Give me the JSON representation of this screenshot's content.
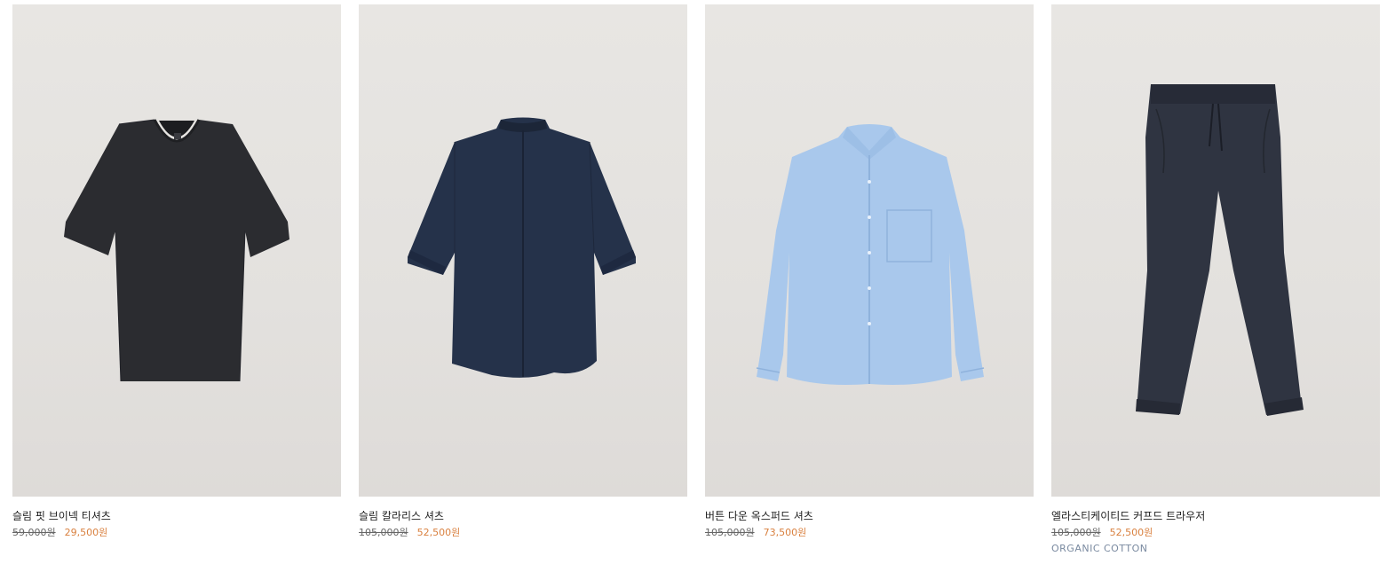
{
  "products": [
    {
      "image_alt": "black-vneck-tshirt",
      "name": "슬림 핏 브이넥 티셔츠",
      "original_price": "59,000원",
      "sale_price": "29,500원",
      "tag": ""
    },
    {
      "image_alt": "navy-collarless-shirt",
      "name": "슬림 칼라리스 셔츠",
      "original_price": "105,000원",
      "sale_price": "52,500원",
      "tag": ""
    },
    {
      "image_alt": "light-blue-oxford-shirt",
      "name": "버튼 다운 옥스퍼드 셔츠",
      "original_price": "105,000원",
      "sale_price": "73,500원",
      "tag": ""
    },
    {
      "image_alt": "navy-cuffed-trousers",
      "name": "엘라스티케이티드 커프드 트라우저",
      "original_price": "105,000원",
      "sale_price": "52,500원",
      "tag": "ORGANIC COTTON"
    }
  ],
  "colors": {
    "sale": "#d9803f",
    "tag": "#7a8aa0",
    "background": "#e6e4e1"
  }
}
